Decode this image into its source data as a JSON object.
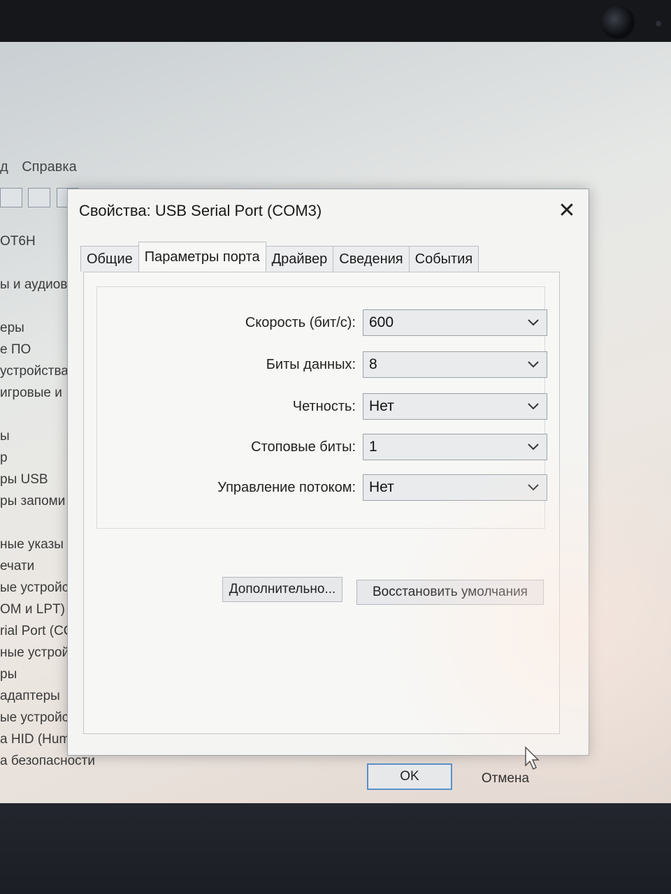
{
  "background_window": {
    "menu": [
      "д",
      "Справка"
    ],
    "tree_items": [
      "OT6H",
      "",
      "ы и аудиов",
      "",
      "еры",
      "е ПО",
      "устройства",
      "игровые и",
      "",
      "ы",
      "р",
      "ры USB",
      "ры запоми",
      "",
      "ные указы",
      "ечати",
      "ые устройс",
      "OM и LPT)",
      "rial Port (CC",
      "ные устрой",
      "ры",
      "адаптеры",
      "ые устройст",
      "а HID (Human Interface Devices)",
      "а безопасности"
    ]
  },
  "dialog": {
    "title": "Свойства: USB Serial Port (COM3)",
    "close_glyph": "✕",
    "tabs": [
      "Общие",
      "Параметры порта",
      "Драйвер",
      "Сведения",
      "События"
    ],
    "active_tab": "Параметры порта",
    "settings": {
      "baud_label": "Скорость (бит/с):",
      "baud_value": "600",
      "data_bits_label": "Биты данных:",
      "data_bits_value": "8",
      "parity_label": "Четность:",
      "parity_value": "Нет",
      "stop_bits_label": "Стоповые биты:",
      "stop_bits_value": "1",
      "flow_label": "Управление потоком:",
      "flow_value": "Нет"
    },
    "advanced_button": "Дополнительно...",
    "restore_defaults_button": "Восстановить умолчания",
    "ok_button": "OK",
    "cancel_button": "Отмена"
  },
  "icons": {
    "close": "close-icon",
    "dropdown": "chevron-down-icon",
    "pointer": "mouse-pointer-icon"
  }
}
